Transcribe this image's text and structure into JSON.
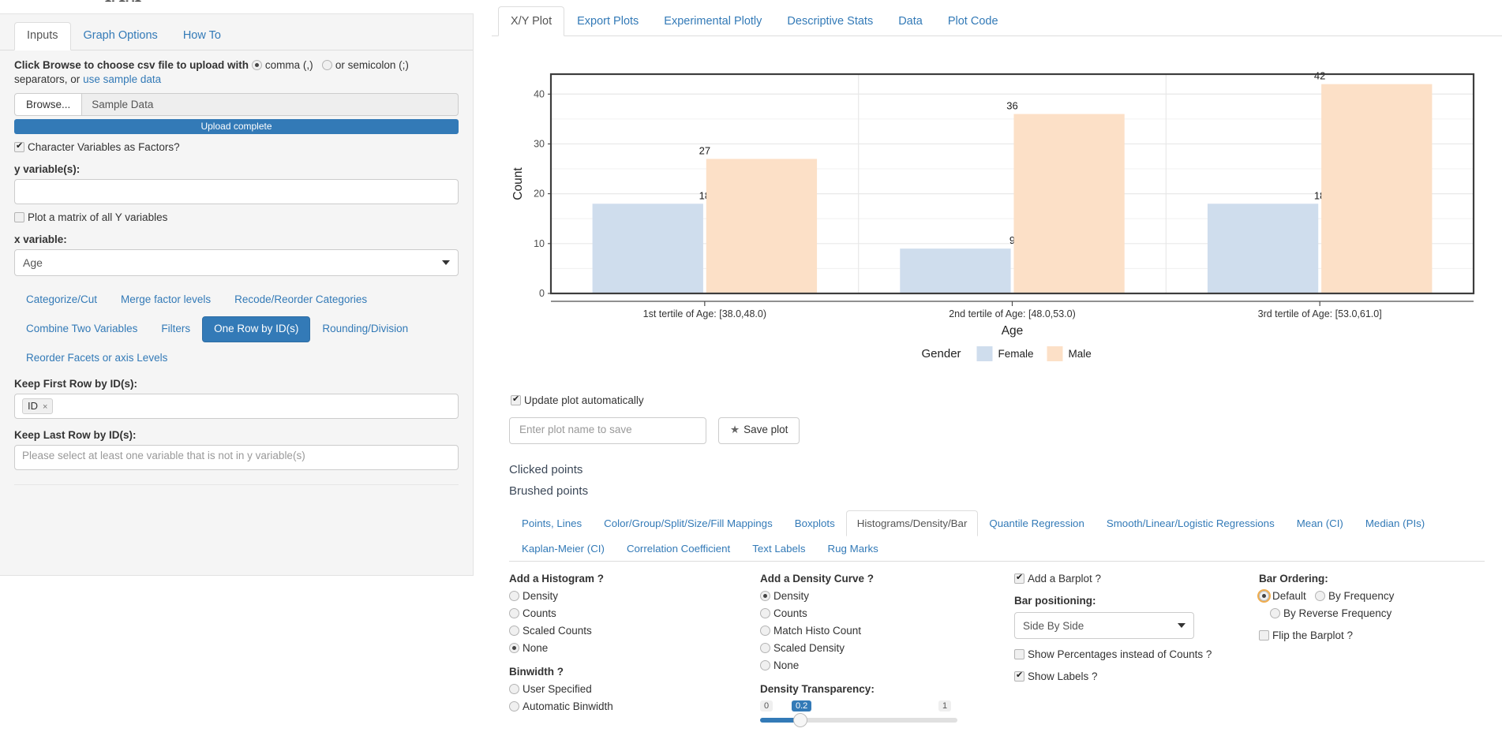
{
  "app": {
    "title_fragment": "ggp"
  },
  "sidebar": {
    "tabs": [
      {
        "label": "Inputs",
        "active": true
      },
      {
        "label": "Graph Options",
        "active": false
      },
      {
        "label": "How To",
        "active": false
      }
    ],
    "upload_help_pre": "Click Browse to choose csv file to upload with",
    "sep_comma": "comma (,)",
    "sep_semicolon": "or semicolon (;)",
    "upload_help_post": "separators, or",
    "sample_link": "use sample data",
    "browse_button": "Browse...",
    "file_name": "Sample Data",
    "progress_label": "Upload complete",
    "char_factors_label": "Character Variables as Factors?",
    "y_variable_label": "y variable(s):",
    "y_variable_value": "",
    "matrix_label": "Plot a matrix of all Y variables",
    "x_variable_label": "x variable:",
    "x_variable_value": "Age",
    "transform_buttons": [
      {
        "label": "Categorize/Cut",
        "active": false
      },
      {
        "label": "Merge factor levels",
        "active": false
      },
      {
        "label": "Recode/Reorder Categories",
        "active": false
      },
      {
        "label": "Combine Two Variables",
        "active": false
      },
      {
        "label": "Filters",
        "active": false
      },
      {
        "label": "One Row by ID(s)",
        "active": true
      },
      {
        "label": "Rounding/Division",
        "active": false
      },
      {
        "label": "Reorder Facets or axis Levels",
        "active": false
      }
    ],
    "keep_first_label": "Keep First Row by ID(s):",
    "keep_first_token": "ID",
    "keep_last_label": "Keep Last Row by ID(s):",
    "keep_last_placeholder": "Please select at least one variable that is not in y variable(s)"
  },
  "main": {
    "tabs": [
      {
        "label": "X/Y Plot",
        "active": true
      },
      {
        "label": "Export Plots",
        "active": false
      },
      {
        "label": "Experimental Plotly",
        "active": false
      },
      {
        "label": "Descriptive Stats",
        "active": false
      },
      {
        "label": "Data",
        "active": false
      },
      {
        "label": "Plot Code",
        "active": false
      }
    ],
    "update_auto_label": "Update plot automatically",
    "plot_name_placeholder": "Enter plot name to save",
    "save_plot_label": "Save plot",
    "clicked_points_label": "Clicked points",
    "brushed_points_label": "Brushed points",
    "lower_tabs": [
      {
        "label": "Points, Lines",
        "active": false
      },
      {
        "label": "Color/Group/Split/Size/Fill Mappings",
        "active": false
      },
      {
        "label": "Boxplots",
        "active": false
      },
      {
        "label": "Histograms/Density/Bar",
        "active": true
      },
      {
        "label": "Quantile Regression",
        "active": false
      },
      {
        "label": "Smooth/Linear/Logistic Regressions",
        "active": false
      },
      {
        "label": "Mean (CI)",
        "active": false
      },
      {
        "label": "Median (PIs)",
        "active": false
      },
      {
        "label": "Kaplan-Meier (CI)",
        "active": false
      },
      {
        "label": "Correlation Coefficient",
        "active": false
      },
      {
        "label": "Text Labels",
        "active": false
      },
      {
        "label": "Rug Marks",
        "active": false
      }
    ]
  },
  "options": {
    "histogram": {
      "heading": "Add a Histogram ?",
      "items": [
        {
          "label": "Density",
          "selected": false
        },
        {
          "label": "Counts",
          "selected": false
        },
        {
          "label": "Scaled Counts",
          "selected": false
        },
        {
          "label": "None",
          "selected": true
        }
      ],
      "binwidth_heading": "Binwidth ?",
      "binwidth_items": [
        {
          "label": "User Specified",
          "selected": false
        },
        {
          "label": "Automatic Binwidth",
          "selected": false
        }
      ]
    },
    "density": {
      "heading": "Add a Density Curve ?",
      "items": [
        {
          "label": "Density",
          "selected": true
        },
        {
          "label": "Counts",
          "selected": false
        },
        {
          "label": "Match Histo Count",
          "selected": false
        },
        {
          "label": "Scaled Density",
          "selected": false
        },
        {
          "label": "None",
          "selected": false
        }
      ],
      "transparency_heading": "Density Transparency:",
      "transparency_min": "0",
      "transparency_value": "0.2",
      "transparency_max": "1"
    },
    "barplot": {
      "add_barplot_label": "Add a Barplot ?",
      "add_barplot_checked": true,
      "bar_positioning_label": "Bar positioning:",
      "bar_positioning_value": "Side By Side",
      "show_percentages_label": "Show Percentages instead of Counts ?",
      "show_percentages_checked": false,
      "show_labels_label": "Show Labels ?",
      "show_labels_checked": true
    },
    "ordering": {
      "heading": "Bar Ordering:",
      "items": [
        {
          "label": "Default",
          "selected": true
        },
        {
          "label": "By Frequency",
          "selected": false
        },
        {
          "label": "By Reverse Frequency",
          "selected": false
        }
      ],
      "flip_label": "Flip the Barplot ?",
      "flip_checked": false
    }
  },
  "chart_data": {
    "type": "bar",
    "title": "",
    "xlabel": "Age",
    "ylabel": "Count",
    "categories": [
      "1st tertile of Age: [38.0,48.0)",
      "2nd tertile of Age: [48.0,53.0)",
      "3rd tertile of Age: [53.0,61.0]"
    ],
    "series": [
      {
        "name": "Female",
        "color": "#cfdded",
        "values": [
          18,
          9,
          18
        ]
      },
      {
        "name": "Male",
        "color": "#fce0c7",
        "values": [
          27,
          36,
          42
        ]
      }
    ],
    "legend_title": "Gender",
    "legend_position": "bottom",
    "yticks": [
      0,
      10,
      20,
      30,
      40
    ],
    "ylim": [
      0,
      44
    ],
    "grid": true,
    "labels_shown": true
  }
}
